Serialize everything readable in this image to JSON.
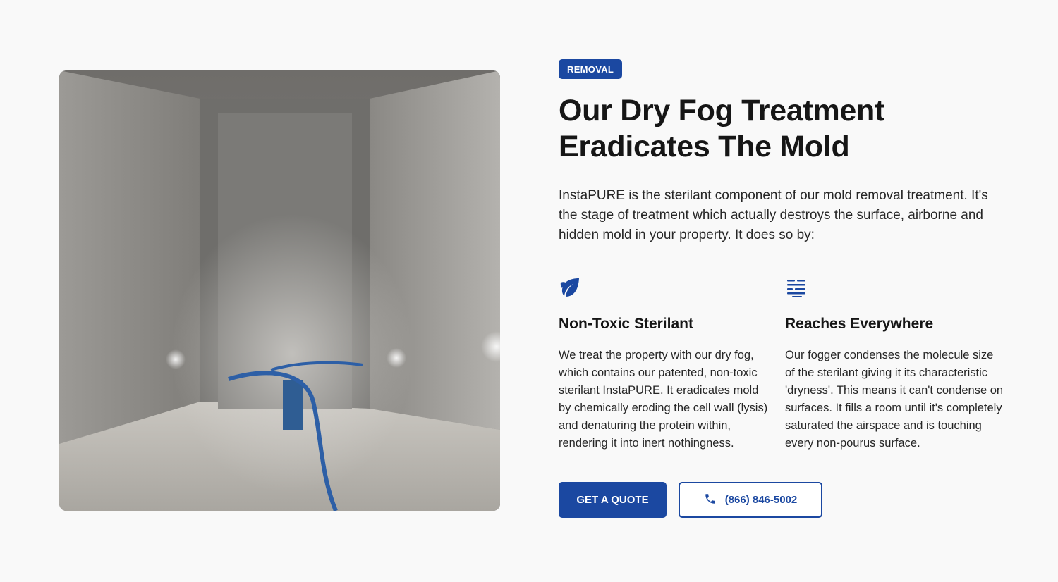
{
  "badge": "REMOVAL",
  "title_line1": "Our Dry Fog Treatment",
  "title_line2": "Eradicates The Mold",
  "intro": "InstaPURE is the sterilant component of our mold removal treatment. It's the stage of treatment which actually destroys the surface, airborne and hidden mold in your property. It does so by:",
  "features": [
    {
      "icon": "leaf-icon",
      "title": "Non-Toxic Sterilant",
      "text": "We treat the property with our dry fog, which contains our patented, non-toxic sterilant InstaPURE. It eradicates mold by chemically eroding the cell wall (lysis) and denaturing the protein within, rendering it into inert nothingness."
    },
    {
      "icon": "fog-icon",
      "title": "Reaches Everywhere",
      "text": "Our fogger condenses the molecule size of the sterilant giving it its characteristic 'dryness'. This means it can't condense on surfaces. It fills a room until it's completely saturated the airspace and is touching every non-pourus surface."
    }
  ],
  "actions": {
    "quote_label": "GET A QUOTE",
    "phone_label": "(866) 846-5002",
    "phone_icon": "phone-icon"
  },
  "colors": {
    "accent": "#1b48a1",
    "background": "#f9f9f9",
    "text": "#161616"
  }
}
